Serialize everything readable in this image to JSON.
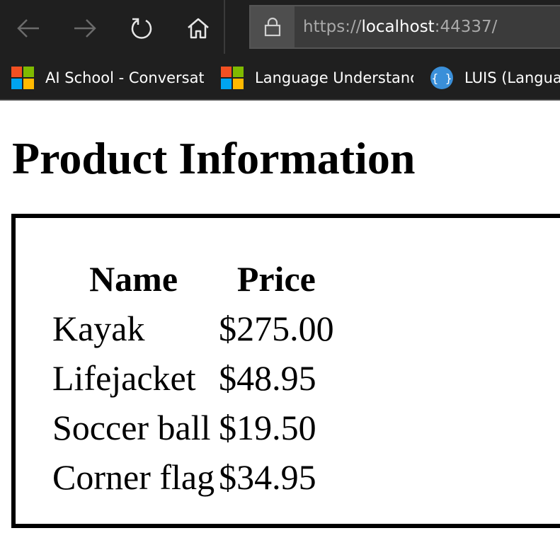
{
  "browser": {
    "nav": {
      "back_icon": "arrow-left-icon",
      "forward_icon": "arrow-right-icon",
      "refresh_icon": "refresh-icon",
      "home_icon": "home-icon"
    },
    "address": {
      "scheme": "https://",
      "host": "localhost",
      "port_path": ":44337/",
      "lock_icon": "lock-icon"
    },
    "favorites": [
      {
        "label": "AI School - Conversat",
        "icon": "microsoft-logo-icon"
      },
      {
        "label": "Language Understanc",
        "icon": "microsoft-logo-icon"
      },
      {
        "label": "LUIS (Langua",
        "icon": "curly-braces-icon",
        "icon_text": "{ }"
      }
    ]
  },
  "page": {
    "title": "Product Information",
    "table": {
      "headers": [
        "Name",
        "Price"
      ],
      "rows": [
        [
          "Kayak",
          "$275.00"
        ],
        [
          "Lifejacket",
          "$48.95"
        ],
        [
          "Soccer ball",
          "$19.50"
        ],
        [
          "Corner flag",
          "$34.95"
        ]
      ]
    }
  },
  "colors": {
    "chrome_bg": "#1f1f1f",
    "address_bg": "#3b3b3b",
    "ms_red": "#f25022",
    "ms_green": "#7fba00",
    "ms_blue": "#00a4ef",
    "ms_yellow": "#ffb900",
    "luis_blue": "#3a8fd9"
  }
}
